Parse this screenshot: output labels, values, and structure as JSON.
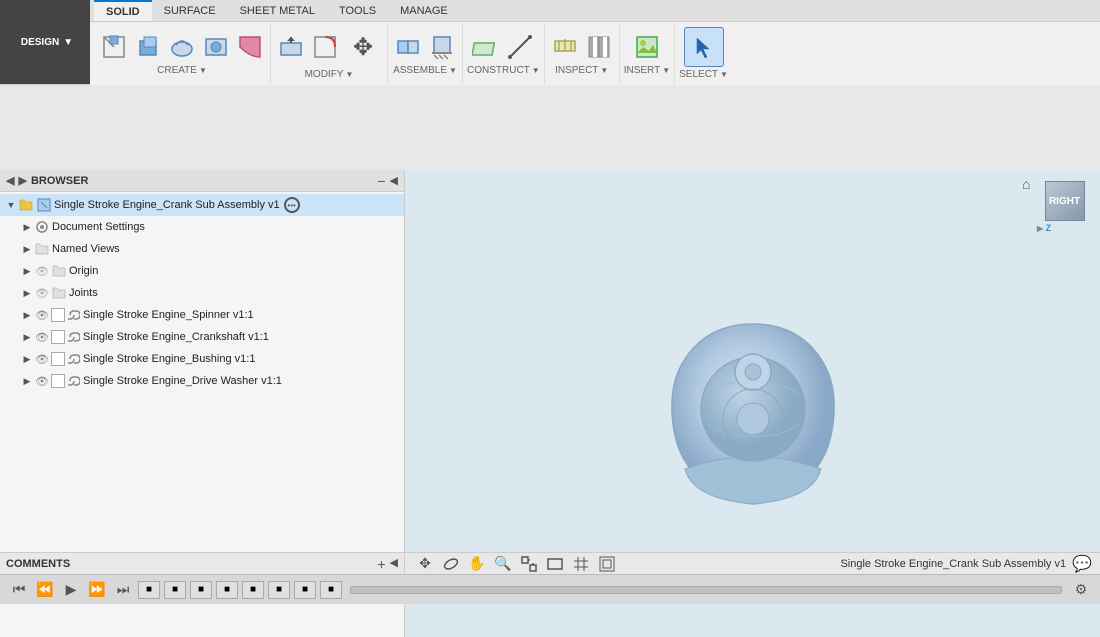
{
  "app": {
    "title": "Single Stroke Engine_Crank Sub Assembly v1"
  },
  "tabs": [
    {
      "label": "SOLID",
      "active": true
    },
    {
      "label": "SURFACE",
      "active": false
    },
    {
      "label": "SHEET METAL",
      "active": false
    },
    {
      "label": "TOOLS",
      "active": false
    },
    {
      "label": "MANAGE",
      "active": false
    }
  ],
  "design_button": {
    "label": "DESIGN",
    "arrow": "▼"
  },
  "toolbar_groups": [
    {
      "name": "CREATE",
      "has_arrow": true,
      "icons": [
        "create1",
        "create2",
        "create3",
        "create4",
        "create5"
      ]
    },
    {
      "name": "MODIFY",
      "has_arrow": true,
      "icons": [
        "mod1",
        "mod2",
        "mod3"
      ]
    },
    {
      "name": "ASSEMBLE",
      "has_arrow": true,
      "icons": [
        "asm1",
        "asm2"
      ]
    },
    {
      "name": "CONSTRUCT",
      "has_arrow": true,
      "icons": [
        "con1",
        "con2"
      ]
    },
    {
      "name": "INSPECT",
      "has_arrow": true,
      "icons": [
        "ins1",
        "ins2"
      ]
    },
    {
      "name": "INSERT",
      "has_arrow": true,
      "icons": [
        "ins1"
      ]
    },
    {
      "name": "SELECT",
      "has_arrow": true,
      "icons": [
        "sel1"
      ]
    }
  ],
  "browser": {
    "header": "BROWSER",
    "root_item": "Single Stroke Engine_Crank Sub Assembly v1",
    "items": [
      {
        "label": "Document Settings",
        "indent": 1,
        "expandable": true,
        "type": "settings"
      },
      {
        "label": "Named Views",
        "indent": 1,
        "expandable": true,
        "type": "folder"
      },
      {
        "label": "Origin",
        "indent": 1,
        "expandable": true,
        "type": "folder",
        "hidden": true
      },
      {
        "label": "Joints",
        "indent": 1,
        "expandable": true,
        "type": "folder",
        "hidden": true
      },
      {
        "label": "Single Stroke Engine_Spinner v1:1",
        "indent": 2,
        "expandable": true,
        "type": "component",
        "has_eye": true,
        "has_check": true,
        "has_link": true
      },
      {
        "label": "Single Stroke Engine_Crankshaft v1:1",
        "indent": 2,
        "expandable": true,
        "type": "component",
        "has_eye": true,
        "has_check": true,
        "has_link": true
      },
      {
        "label": "Single Stroke Engine_Bushing v1:1",
        "indent": 2,
        "expandable": true,
        "type": "component",
        "has_eye": true,
        "has_check": true,
        "has_link": true
      },
      {
        "label": "Single Stroke Engine_Drive Washer v1:1",
        "indent": 2,
        "expandable": true,
        "type": "component",
        "has_eye": true,
        "has_check": true,
        "has_link": true
      }
    ]
  },
  "viewcube": {
    "face_label": "RIGHT",
    "home_icon": "⌂"
  },
  "bottom_bar": {
    "comments_label": "COMMENTS",
    "add_icon": "+",
    "collapse_icon": "◀",
    "status_text": "Single Stroke Engine_Crank Sub Assembly v1",
    "chat_icon": "💬"
  },
  "bottom_row": {
    "playback_icons": [
      "⏮",
      "⏪",
      "▶",
      "⏩",
      "⏭"
    ],
    "timeline_frames": [
      "■",
      "■",
      "■",
      "■",
      "■",
      "■",
      "■",
      "■"
    ],
    "settings_icon": "⚙"
  },
  "icons": {
    "create_box": "⬜",
    "create_cylinder": "⬭",
    "create_sphere": "○",
    "create_extrude": "⬛",
    "create_revolve": "↻",
    "move": "✥",
    "assemble": "🔧",
    "construct_plane": "◼",
    "construct_axis": "—",
    "measure": "📏",
    "insert_img": "🖼",
    "select_cursor": "↖"
  }
}
